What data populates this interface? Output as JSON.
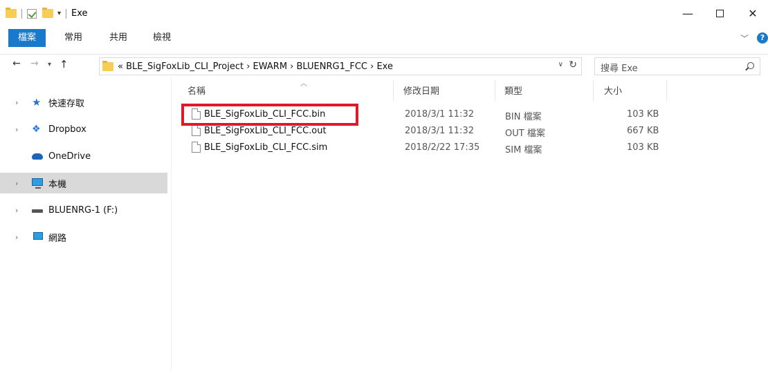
{
  "window": {
    "title": "Exe"
  },
  "ribbon": {
    "tabs": [
      "檔案",
      "常用",
      "共用",
      "檢視"
    ]
  },
  "address": {
    "breadcrumb": [
      "«",
      "BLE_SigFoxLib_CLI_Project",
      "›",
      "EWARM",
      "›",
      "BLUENRG1_FCC",
      "›",
      "Exe"
    ],
    "breadcrumb_text": "«  BLE_SigFoxLib_CLI_Project  ›  EWARM  ›  BLUENRG1_FCC  ›  Exe"
  },
  "search": {
    "placeholder": "搜尋 Exe"
  },
  "nav_pane": {
    "items": [
      {
        "label": "快速存取",
        "icon": "star-icon"
      },
      {
        "label": "Dropbox",
        "icon": "dropbox-icon"
      },
      {
        "label": "OneDrive",
        "icon": "onedrive-icon"
      },
      {
        "label": "本機",
        "icon": "this-pc-icon",
        "selected": true
      },
      {
        "label": "BLUENRG-1 (F:)",
        "icon": "drive-icon"
      },
      {
        "label": "網路",
        "icon": "network-icon"
      }
    ]
  },
  "list": {
    "columns": [
      "名稱",
      "修改日期",
      "類型",
      "大小"
    ],
    "rows": [
      {
        "name": "BLE_SigFoxLib_CLI_FCC.bin",
        "date": "2018/3/1 11:32",
        "type": "BIN 檔案",
        "size": "103 KB",
        "highlighted": true
      },
      {
        "name": "BLE_SigFoxLib_CLI_FCC.out",
        "date": "2018/3/1 11:32",
        "type": "OUT 檔案",
        "size": "667 KB"
      },
      {
        "name": "BLE_SigFoxLib_CLI_FCC.sim",
        "date": "2018/2/22 17:35",
        "type": "SIM 檔案",
        "size": "103 KB"
      }
    ]
  },
  "colors": {
    "accent": "#1979ca",
    "highlight": "#e0182a",
    "selected_bg": "#d9d9d9"
  }
}
